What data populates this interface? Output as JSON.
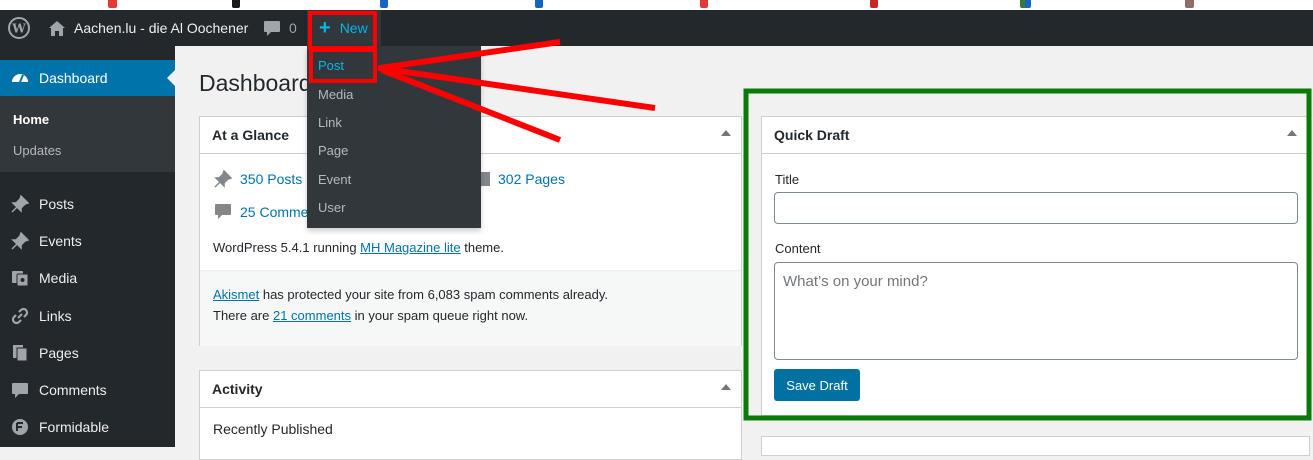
{
  "adminbar": {
    "site_name": "Aachen.lu - die Al Oochener",
    "comments_count": "0",
    "new_label": "New",
    "new_menu": [
      "Post",
      "Media",
      "Link",
      "Page",
      "Event",
      "User"
    ]
  },
  "sidebar": {
    "active": "Dashboard",
    "submenu": [
      "Home",
      "Updates"
    ],
    "items": [
      "Posts",
      "Events",
      "Media",
      "Links",
      "Pages",
      "Comments",
      "Formidable"
    ]
  },
  "page": {
    "title": "Dashboard"
  },
  "at_a_glance": {
    "title": "At a Glance",
    "posts": "350 Posts",
    "pages": "302 Pages",
    "comments": "25 Comme",
    "version_prefix": "WordPress 5.4.1 running ",
    "theme": "MH Magazine lite",
    "version_suffix": " theme.",
    "akismet": "Akismet",
    "akismet_text": " has protected your site from 6,083 spam comments already.",
    "spam_prefix": "There are ",
    "spam_link": "21 comments",
    "spam_suffix": " in your spam queue right now."
  },
  "activity": {
    "title": "Activity",
    "recently": "Recently Published"
  },
  "quick_draft": {
    "title": "Quick Draft",
    "title_label": "Title",
    "title_value": "",
    "content_label": "Content",
    "content_placeholder": "What’s on your mind?",
    "save_label": "Save Draft"
  },
  "colors": {
    "accent": "#0073aa",
    "annotation_red": "#ff0000",
    "annotation_green": "#0a7a0a"
  }
}
